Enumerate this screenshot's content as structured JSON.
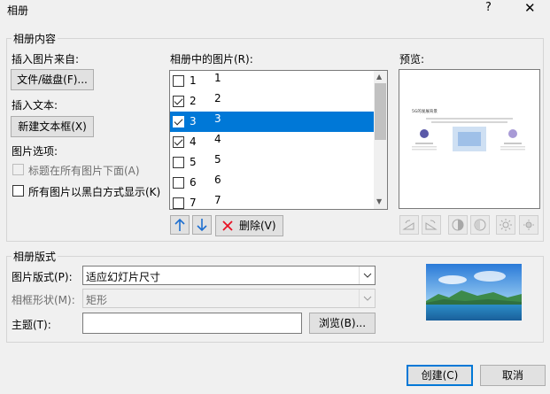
{
  "window": {
    "title": "相册",
    "help": "?",
    "close": "✕"
  },
  "content_group": {
    "legend": "相册内容",
    "insert_from_label": "插入图片来自:",
    "file_disk_button": "文件/磁盘(F)...",
    "insert_text_label": "插入文本:",
    "new_textbox_button": "新建文本框(X)",
    "picture_options_label": "图片选项:",
    "captions_below_label": "标题在所有图片下面(A)",
    "black_white_label": "所有图片以黑白方式显示(K)",
    "pictures_label": "相册中的图片(R):",
    "pictures": [
      {
        "num": "1",
        "name": "1",
        "checked": false,
        "selected": false
      },
      {
        "num": "2",
        "name": "2",
        "checked": true,
        "selected": false
      },
      {
        "num": "3",
        "name": "3",
        "checked": true,
        "selected": true
      },
      {
        "num": "4",
        "name": "4",
        "checked": true,
        "selected": false
      },
      {
        "num": "5",
        "name": "5",
        "checked": false,
        "selected": false
      },
      {
        "num": "6",
        "name": "6",
        "checked": false,
        "selected": false
      },
      {
        "num": "7",
        "name": "7",
        "checked": false,
        "selected": false
      }
    ],
    "delete_button": "删除(V)",
    "preview_label": "预览:",
    "preview_slide": {
      "title": "5G的发展背景"
    }
  },
  "layout_group": {
    "legend": "相册版式",
    "picture_layout_label": "图片版式(P):",
    "picture_layout_value": "适应幻灯片尺寸",
    "frame_shape_label": "相框形状(M):",
    "frame_shape_value": "矩形",
    "theme_label": "主题(T):",
    "theme_value": "",
    "browse_button": "浏览(B)..."
  },
  "footer": {
    "create_button": "创建(C)",
    "cancel_button": "取消"
  },
  "colors": {
    "accent": "#0078d7",
    "selection": "#0078d7",
    "delete_red": "#e81123"
  }
}
